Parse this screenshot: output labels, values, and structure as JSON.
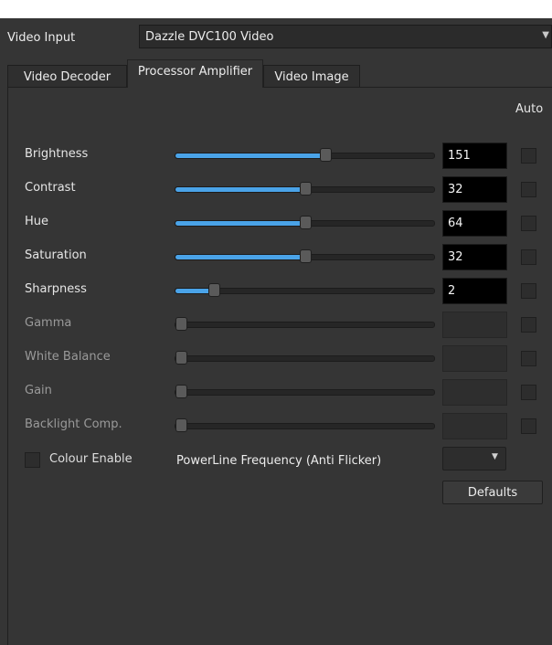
{
  "video_input": {
    "label": "Video Input",
    "selected": "Dazzle DVC100 Video"
  },
  "tabs": [
    {
      "label": "Video Decoder",
      "active": false
    },
    {
      "label": "Processor Amplifier",
      "active": true
    },
    {
      "label": "Video Image",
      "active": false
    }
  ],
  "auto_label": "Auto",
  "rows": [
    {
      "label": "Brightness",
      "value": "151",
      "fraction": 0.58,
      "enabled": true
    },
    {
      "label": "Contrast",
      "value": "32",
      "fraction": 0.5,
      "enabled": true
    },
    {
      "label": "Hue",
      "value": "64",
      "fraction": 0.5,
      "enabled": true
    },
    {
      "label": "Saturation",
      "value": "32",
      "fraction": 0.5,
      "enabled": true
    },
    {
      "label": "Sharpness",
      "value": "2",
      "fraction": 0.15,
      "enabled": true
    },
    {
      "label": "Gamma",
      "value": "",
      "fraction": 0.0,
      "enabled": false
    },
    {
      "label": "White Balance",
      "value": "",
      "fraction": 0.0,
      "enabled": false
    },
    {
      "label": "Gain",
      "value": "",
      "fraction": 0.0,
      "enabled": false
    },
    {
      "label": "Backlight Comp.",
      "value": "",
      "fraction": 0.0,
      "enabled": false
    }
  ],
  "colour_enable": {
    "label": "Colour Enable",
    "checked": false
  },
  "powerline": {
    "label": "PowerLine Frequency (Anti Flicker)",
    "selected": ""
  },
  "defaults_button": "Defaults",
  "colors": {
    "accent": "#4aa3e8",
    "background": "#353535",
    "value_box": "#000000"
  }
}
